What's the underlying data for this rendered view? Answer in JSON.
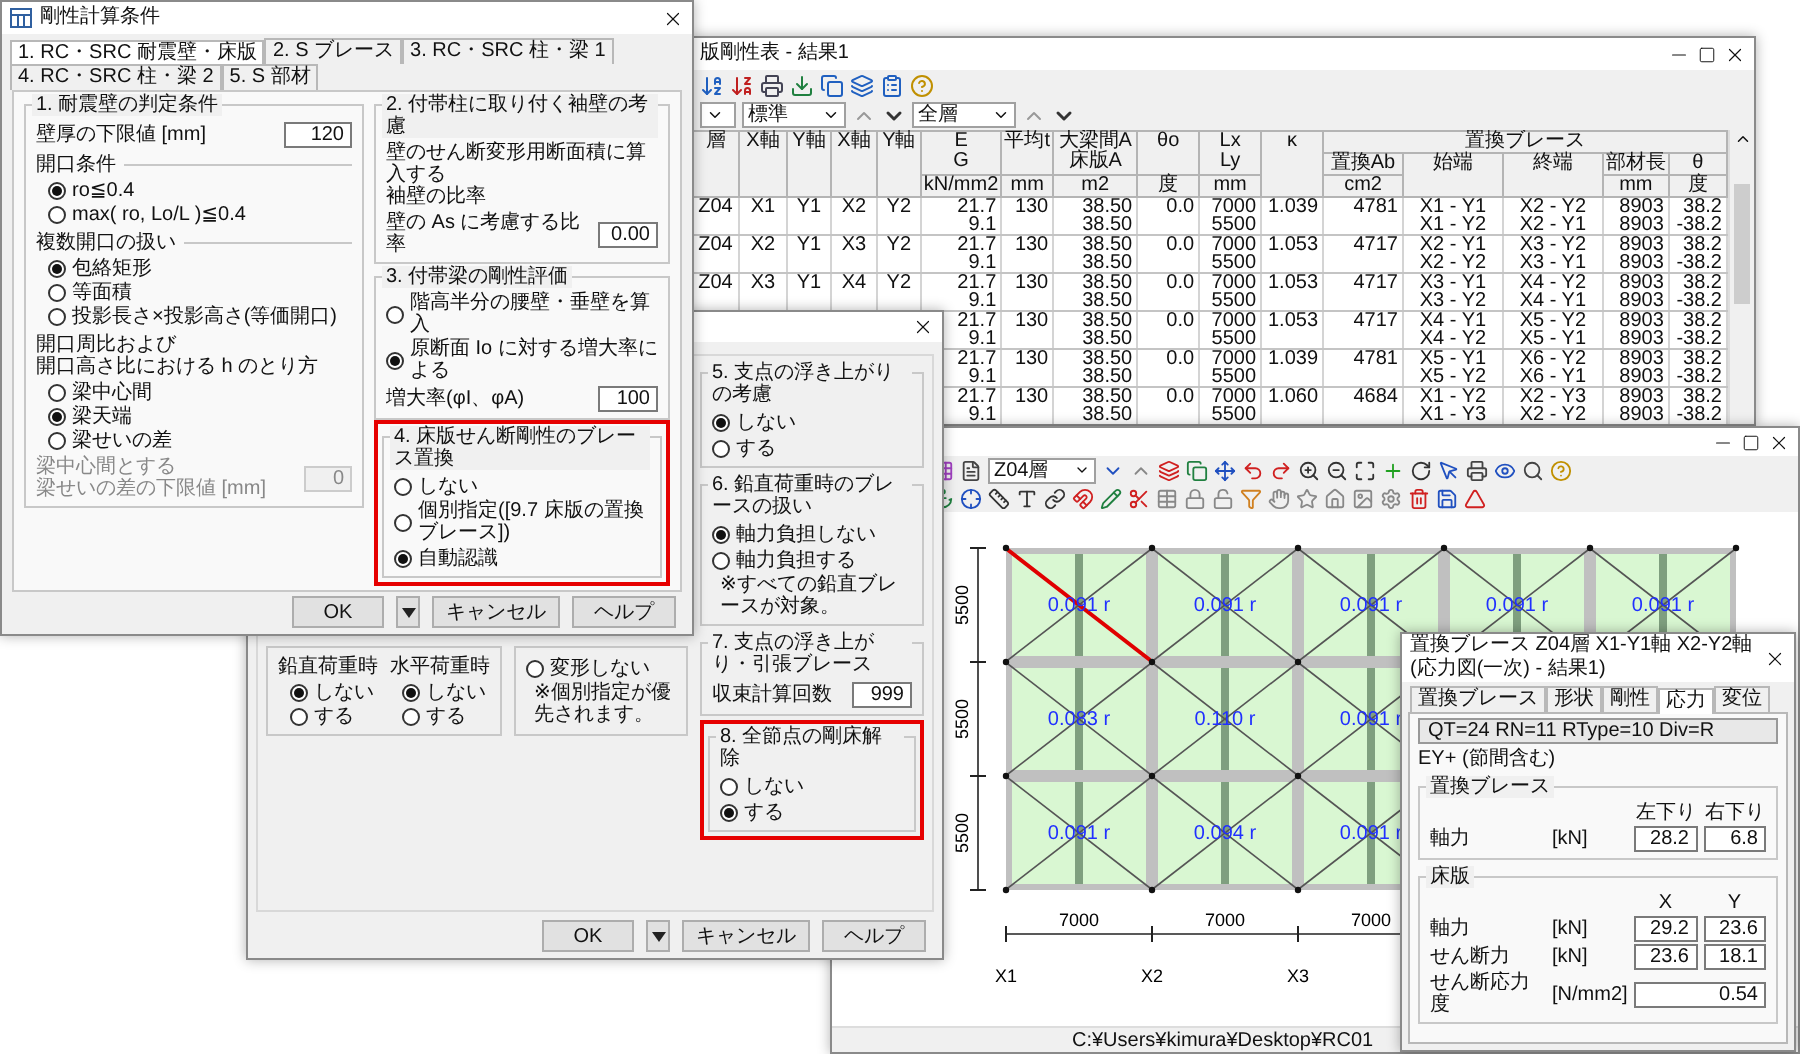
{
  "table_window": {
    "title": "版剛性表 - 結果1",
    "filters": [
      "標準",
      "全層"
    ],
    "table": {
      "columns": [
        {
          "lines": [
            "層"
          ]
        },
        {
          "lines": [
            "X軸"
          ]
        },
        {
          "lines": [
            "Y軸"
          ]
        },
        {
          "lines": [
            "X軸"
          ]
        },
        {
          "lines": [
            "Y軸"
          ]
        },
        {
          "lines": [
            "E",
            "G"
          ],
          "unit": "kN/mm2"
        },
        {
          "lines": [
            "平均t"
          ],
          "unit": "mm"
        },
        {
          "lines": [
            "大梁間A",
            "床版A"
          ],
          "unit": "m2"
        },
        {
          "lines": [
            "θo"
          ],
          "unit": "度"
        },
        {
          "lines": [
            "Lx",
            "Ly"
          ],
          "unit": "mm"
        },
        {
          "lines": [
            "κ"
          ]
        }
      ],
      "brace_group": {
        "title": "置換ブレース",
        "columns": [
          {
            "lines": [
              "置換Ab"
            ],
            "unit": "cm2"
          },
          {
            "lines": [
              "始端"
            ]
          },
          {
            "lines": [
              "終端"
            ]
          },
          {
            "lines": [
              "部材長"
            ],
            "unit": "mm"
          },
          {
            "lines": [
              "θ"
            ],
            "unit": "度"
          }
        ]
      },
      "rows": [
        {
          "axes": [
            "Z04",
            "X1",
            "Y1",
            "X2",
            "Y2"
          ],
          "values": [
            [
              "21.7",
              "9.1"
            ],
            [
              "130"
            ],
            [
              "38.50",
              "38.50"
            ],
            [
              "0.0"
            ],
            [
              "7000",
              "5500"
            ],
            [
              "1.039"
            ],
            [
              "4781"
            ],
            [
              "X1 - Y1",
              "X1 - Y2"
            ],
            [
              "X2 - Y2",
              "X2 - Y1"
            ],
            [
              "8903",
              "8903"
            ],
            [
              "38.2",
              "-38.2"
            ]
          ]
        },
        {
          "axes": [
            "Z04",
            "X2",
            "Y1",
            "X3",
            "Y2"
          ],
          "values": [
            [
              "21.7",
              "9.1"
            ],
            [
              "130"
            ],
            [
              "38.50",
              "38.50"
            ],
            [
              "0.0"
            ],
            [
              "7000",
              "5500"
            ],
            [
              "1.053"
            ],
            [
              "4717"
            ],
            [
              "X2 - Y1",
              "X2 - Y2"
            ],
            [
              "X3 - Y2",
              "X3 - Y1"
            ],
            [
              "8903",
              "8903"
            ],
            [
              "38.2",
              "-38.2"
            ]
          ]
        },
        {
          "axes": [
            "Z04",
            "X3",
            "Y1",
            "X4",
            "Y2"
          ],
          "values": [
            [
              "21.7",
              "9.1"
            ],
            [
              "130"
            ],
            [
              "38.50",
              "38.50"
            ],
            [
              "0.0"
            ],
            [
              "7000",
              "5500"
            ],
            [
              "1.053"
            ],
            [
              "4717"
            ],
            [
              "X3 - Y1",
              "X3 - Y2"
            ],
            [
              "X4 - Y2",
              "X4 - Y1"
            ],
            [
              "8903",
              "8903"
            ],
            [
              "38.2",
              "-38.2"
            ]
          ]
        },
        {
          "values": [
            [
              "21.7",
              "9.1"
            ],
            [
              "130"
            ],
            [
              "38.50",
              "38.50"
            ],
            [
              "0.0"
            ],
            [
              "7000",
              "5500"
            ],
            [
              "1.053"
            ],
            [
              "4717"
            ],
            [
              "X4 - Y1",
              "X4 - Y2"
            ],
            [
              "X5 - Y2",
              "X5 - Y1"
            ],
            [
              "8903",
              "8903"
            ],
            [
              "38.2",
              "-38.2"
            ]
          ]
        },
        {
          "values": [
            [
              "21.7",
              "9.1"
            ],
            [
              "130"
            ],
            [
              "38.50",
              "38.50"
            ],
            [
              "0.0"
            ],
            [
              "7000",
              "5500"
            ],
            [
              "1.039"
            ],
            [
              "4781"
            ],
            [
              "X5 - Y1",
              "X5 - Y2"
            ],
            [
              "X6 - Y2",
              "X6 - Y1"
            ],
            [
              "8903",
              "8903"
            ],
            [
              "38.2",
              "-38.2"
            ]
          ]
        },
        {
          "values": [
            [
              "21.7",
              "9.1"
            ],
            [
              "130"
            ],
            [
              "38.50",
              "38.50"
            ],
            [
              "0.0"
            ],
            [
              "7000",
              "5500"
            ],
            [
              "1.060"
            ],
            [
              "4684"
            ],
            [
              "X1 - Y2",
              "X1 - Y3"
            ],
            [
              "X2 - Y3",
              "X2 - Y2"
            ],
            [
              "8903",
              "8903"
            ],
            [
              "38.2",
              "-38.2"
            ]
          ]
        }
      ]
    }
  },
  "plan_window": {
    "floor": "Z04層",
    "rows": [
      [
        {
          "label": "0.091 r",
          "highlighted": true
        },
        {
          "label": "0.091 r",
          "highlighted": false
        },
        {
          "label": "0.091 r",
          "highlighted": false
        },
        {
          "label": "0.091 r",
          "highlighted": false
        },
        {
          "label": "0.091 r",
          "highlighted": false
        }
      ],
      [
        {
          "label": "0.083 r",
          "highlighted": false
        },
        {
          "label": "0.110 r",
          "highlighted": false
        },
        {
          "label": "0.091 r",
          "highlighted": false
        }
      ],
      [
        {
          "label": "0.091 r",
          "highlighted": false
        },
        {
          "label": "0.094 r",
          "highlighted": false
        },
        {
          "label": "0.091 r",
          "highlighted": false
        }
      ]
    ],
    "row_dims": [
      "5500",
      "5500",
      "5500"
    ],
    "col_dims": [
      "7000",
      "7000",
      "7000"
    ],
    "axes": [
      "X1",
      "X2",
      "X3"
    ],
    "status": "C:¥Users¥kimura¥Desktop¥RC01"
  },
  "member_dialog": {
    "title": "置換ブレース Z04層 X1-Y1軸 X2-Y2軸 (応力図(一次) - 結果1)",
    "tabs": [
      {
        "label": "置換ブレース",
        "selected": false
      },
      {
        "label": "形状",
        "selected": false
      },
      {
        "label": "剛性",
        "selected": false
      },
      {
        "label": "応力",
        "selected": true
      },
      {
        "label": "変位",
        "selected": false
      }
    ],
    "header": "QT=24 RN=11 RType=10 Div=R",
    "case": "EY+ (節間含む)",
    "groups": [
      {
        "title": "置換ブレース",
        "columns": [
          "左下り",
          "右下り"
        ],
        "rows": [
          {
            "label": "軸力",
            "unit": "[kN]",
            "values": [
              "28.2",
              "6.8"
            ]
          }
        ]
      },
      {
        "title": "床版",
        "columns": [
          "X",
          "Y"
        ],
        "rows": [
          {
            "label": "軸力",
            "unit": "[kN]",
            "values": [
              "29.2",
              "23.6"
            ]
          },
          {
            "label": "せん断力",
            "unit": "[kN]",
            "values": [
              "23.6",
              "18.1"
            ]
          },
          {
            "label": "せん断応力度",
            "unit": "[N/mm2]",
            "values": [
              "0.54"
            ]
          }
        ]
      }
    ]
  },
  "options_dialog": {
    "support": {
      "title": "5. 支点の浮き上がりの考慮",
      "options": [
        {
          "label": "しない",
          "selected": true
        },
        {
          "label": "する",
          "selected": false
        }
      ]
    },
    "vertical_brace": {
      "title": "6. 鉛直荷重時のブレースの扱い",
      "options": [
        {
          "label": "軸力負担しない",
          "selected": true
        },
        {
          "label": "軸力負担する",
          "selected": false
        }
      ],
      "note": "※すべての鉛直ブレースが対象。"
    },
    "tension": {
      "title": "7. 支点の浮き上がり・引張ブレース",
      "field_label": "収束計算回数",
      "field_value": "999"
    },
    "rigid_floor": {
      "title": "8. 全節点の剛床解除",
      "highlighted": true,
      "options": [
        {
          "label": "しない",
          "selected": false
        },
        {
          "label": "する",
          "selected": true
        }
      ]
    },
    "load_cases": [
      {
        "title": "鉛直荷重時",
        "options": [
          {
            "label": "しない",
            "selected": true
          },
          {
            "label": "する",
            "selected": false
          }
        ]
      },
      {
        "title": "水平荷重時",
        "options": [
          {
            "label": "しない",
            "selected": true
          },
          {
            "label": "する",
            "selected": false
          }
        ]
      }
    ],
    "deform": {
      "option": {
        "label": "変形しない",
        "selected": false
      },
      "note": "※個別指定が優先されます。"
    },
    "buttons": [
      "OK",
      "キャンセル",
      "ヘルプ"
    ]
  },
  "settings_dialog": {
    "title": "剛性計算条件",
    "tabs": [
      {
        "label": "1. RC・SRC 耐震壁・床版",
        "selected": true
      },
      {
        "label": "2. S ブレース",
        "selected": false
      },
      {
        "label": "3. RC・SRC 柱・梁 1",
        "selected": false
      },
      {
        "label": "4. RC・SRC 柱・梁 2",
        "selected": false
      },
      {
        "label": "5. S 部材",
        "selected": false
      }
    ],
    "wall": {
      "title": "1. 耐震壁の判定条件",
      "thickness_label": "壁厚の下限値 [mm]",
      "thickness_value": "120",
      "opening_title": "開口条件",
      "opening_options": [
        {
          "label": "ro≦0.4",
          "selected": true
        },
        {
          "label": "max( ro, Lo/L )≦0.4",
          "selected": false
        }
      ],
      "multi_title": "複数開口の扱い",
      "multi_options": [
        {
          "label": "包絡矩形",
          "selected": true
        },
        {
          "label": "等面積",
          "selected": false
        },
        {
          "label": "投影長さ×投影高さ(等価開口)",
          "selected": false
        }
      ],
      "ratio_title": [
        "開口周比および",
        "開口高さ比における h のとり方"
      ],
      "ratio_options": [
        {
          "label": "梁中心間",
          "selected": false
        },
        {
          "label": "梁天端",
          "selected": true
        },
        {
          "label": "梁せいの差",
          "selected": false
        }
      ],
      "gap_label": [
        "梁中心間とする",
        "梁せいの差の下限値 [mm]"
      ],
      "gap_value": "0",
      "gap_disabled": true
    },
    "wing": {
      "title": "2. 付帯柱に取り付く袖壁の考慮",
      "note": [
        "壁のせん断変形用断面積に算入する",
        "袖壁の比率"
      ],
      "ratio_label": "壁の As に考慮する比率",
      "ratio_value": "0.00"
    },
    "beam": {
      "title": "3. 付帯梁の剛性評価",
      "options": [
        {
          "label": "階高半分の腰壁・垂壁を算入",
          "selected": false
        },
        {
          "label": "原断面 Io に対する増大率による",
          "selected": true
        }
      ],
      "factor_label": "増大率(φI、φA)",
      "factor_value": "100"
    },
    "brace": {
      "title": "4. 床版せん断剛性のブレース置換",
      "highlighted": true,
      "options": [
        {
          "label": "しない",
          "selected": false
        },
        {
          "label": "個別指定([9.7 床版の置換ブレース])",
          "selected": false
        },
        {
          "label": "自動認識",
          "selected": true
        }
      ]
    },
    "buttons": [
      "OK",
      "キャンセル",
      "ヘルプ"
    ]
  }
}
